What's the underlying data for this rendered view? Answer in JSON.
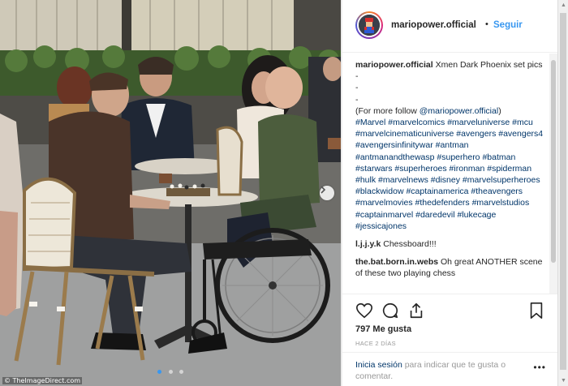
{
  "post": {
    "username": "mariopower.official",
    "follow_separator": "•",
    "follow_label": "Seguir",
    "watermark": "© TheImageDirect.com"
  },
  "caption": {
    "username": "mariopower.official",
    "text": "Xmen Dark Phoenix set pics",
    "dashes": [
      "-",
      "-",
      "-"
    ],
    "follow_note_prefix": "(For more follow ",
    "follow_note_mention": "@mariopower.official",
    "follow_note_suffix": ")",
    "hashtags": "#Marvel #marvelcomics #marveluniverse #mcu #marvelcinematicuniverse #avengers #avengers4 #avengersinfinitywar #antman #antmanandthewasp #superhero #batman #starwars #superheroes #ironman #spiderman #hulk #marvelnews #disney #marvelsuperheroes #blackwidow #captainamerica #theavengers #marvelmovies #thedefenders #marvelstudios #captainmarvel #daredevil #lukecage #jessicajones"
  },
  "comments": [
    {
      "username": "l.j.j.y.k",
      "text": "Chessboard!!!"
    },
    {
      "username": "the.bat.born.in.webs",
      "text": "Oh great ANOTHER scene of these two playing chess"
    }
  ],
  "actions": {
    "like_icon": "heart-icon",
    "comment_icon": "comment-icon",
    "share_icon": "share-icon",
    "save_icon": "bookmark-icon"
  },
  "likes": "797 Me gusta",
  "date": "HACE 2 DÍAS",
  "login": {
    "link": "Inicia sesión",
    "text": " para indicar que te gusta o comentar."
  },
  "more_options": "•••",
  "colors": {
    "link": "#3897f0",
    "hashtag": "#003569",
    "muted": "#999999",
    "text": "#262626"
  }
}
